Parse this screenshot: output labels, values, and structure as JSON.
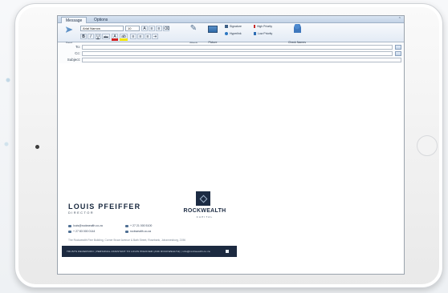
{
  "colors": {
    "ribbon_top": "#f7f9fc",
    "ribbon_bottom": "#e3ebf5",
    "brand_navy": "#1c2b43",
    "high_priority": "#c62828",
    "low_priority": "#2e6db4"
  },
  "tabs": [
    {
      "label": "Message",
      "active": true
    },
    {
      "label": "Options",
      "active": false
    }
  ],
  "ribbon": {
    "send": {
      "label": "Send",
      "icon": "send-icon"
    },
    "font_name": "Arial Narrow",
    "font_size": "10",
    "format_buttons": [
      {
        "name": "bold",
        "label": "B"
      },
      {
        "name": "italic",
        "label": "I"
      },
      {
        "name": "underline",
        "label": "U"
      },
      {
        "name": "strike",
        "label": "abc"
      }
    ],
    "attach_label": "Attach",
    "picture_label": "Picture",
    "signature_label": "Signature",
    "hyperlink_label": "Hyperlink",
    "high_priority_label": "High Priority",
    "low_priority_label": "Low Priority",
    "check_names_label": "Check Names"
  },
  "fields": {
    "to_label": "To:",
    "cc_label": "Cc:",
    "subject_label": "Subject:"
  },
  "signature": {
    "name": "LOUIS PFEIFFER",
    "title": "DIRECTOR",
    "logo_name": "ROCKWEALTH",
    "logo_sub": "CAPITAL",
    "email": "louis@rockwealth.co.za",
    "phone": "+ 27 21 000 5100",
    "mobile": "+ 27 83 000 0144",
    "website": "rockwealth.co.za",
    "address": "The Rockwealth Fine Building, Corner Bruce Avenue & Bath Street, Rosebank, Johannesburg, 2196",
    "banner_text": "TRUSTS REVERSION | PERSONAL ASSISTANT TO LOUIS PFEIFFER (ASK ROCKWEALTH) | info@rockwealth.co.za"
  }
}
